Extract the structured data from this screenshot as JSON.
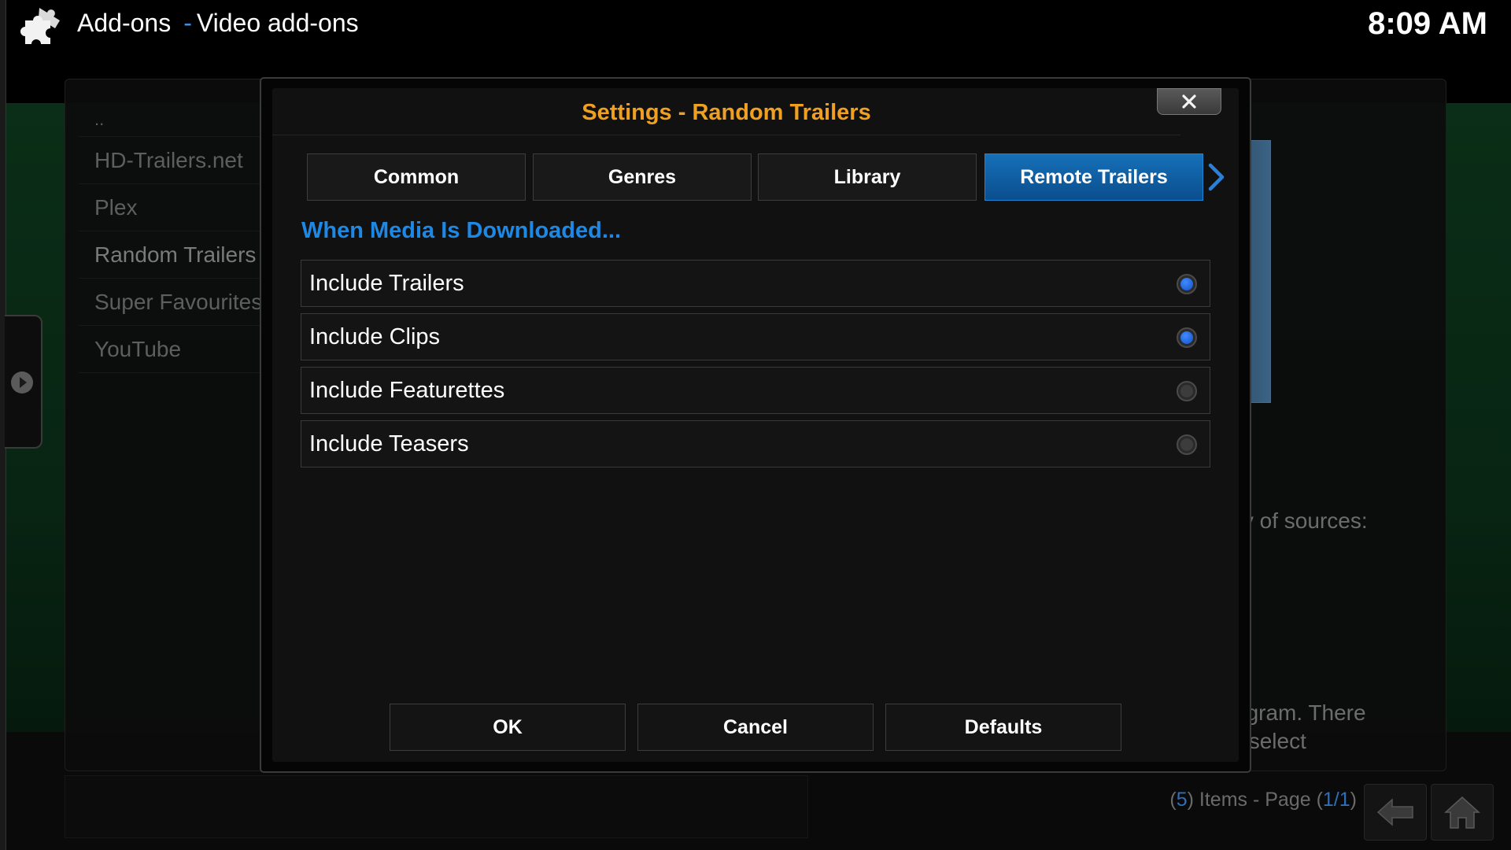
{
  "header": {
    "section": "Add-ons",
    "separator": "-",
    "subsection": "Video add-ons",
    "clock": "8:09 AM",
    "icon": "puzzle-piece-icon"
  },
  "background": {
    "list": [
      {
        "label": ".."
      },
      {
        "label": "HD-Trailers.net"
      },
      {
        "label": "Plex"
      },
      {
        "label": "Random Trailers"
      },
      {
        "label": "Super Favourites"
      },
      {
        "label": "YouTube"
      }
    ],
    "description_line1": "riety of sources:",
    "description_line2": "Program. There",
    "description_line3": "ng, select",
    "items_open": "(",
    "items_count": "5",
    "items_mid": ") Items - Page (",
    "page": "1/1",
    "items_close": ")"
  },
  "dialog": {
    "title": "Settings - Random Trailers",
    "tabs": [
      {
        "label": "Common"
      },
      {
        "label": "Genres"
      },
      {
        "label": "Library"
      },
      {
        "label": "Remote Trailers"
      }
    ],
    "active_tab_index": 3,
    "section_title": "When Media Is Downloaded...",
    "options": [
      {
        "label": "Include Trailers",
        "checked": true
      },
      {
        "label": "Include Clips",
        "checked": true
      },
      {
        "label": "Include Featurettes",
        "checked": false
      },
      {
        "label": "Include Teasers",
        "checked": false
      }
    ],
    "buttons": {
      "ok": "OK",
      "cancel": "Cancel",
      "defaults": "Defaults"
    }
  },
  "colors": {
    "title_orange": "#f0a020",
    "accent_blue": "#1e88e5",
    "active_tab": "#1670b8"
  }
}
